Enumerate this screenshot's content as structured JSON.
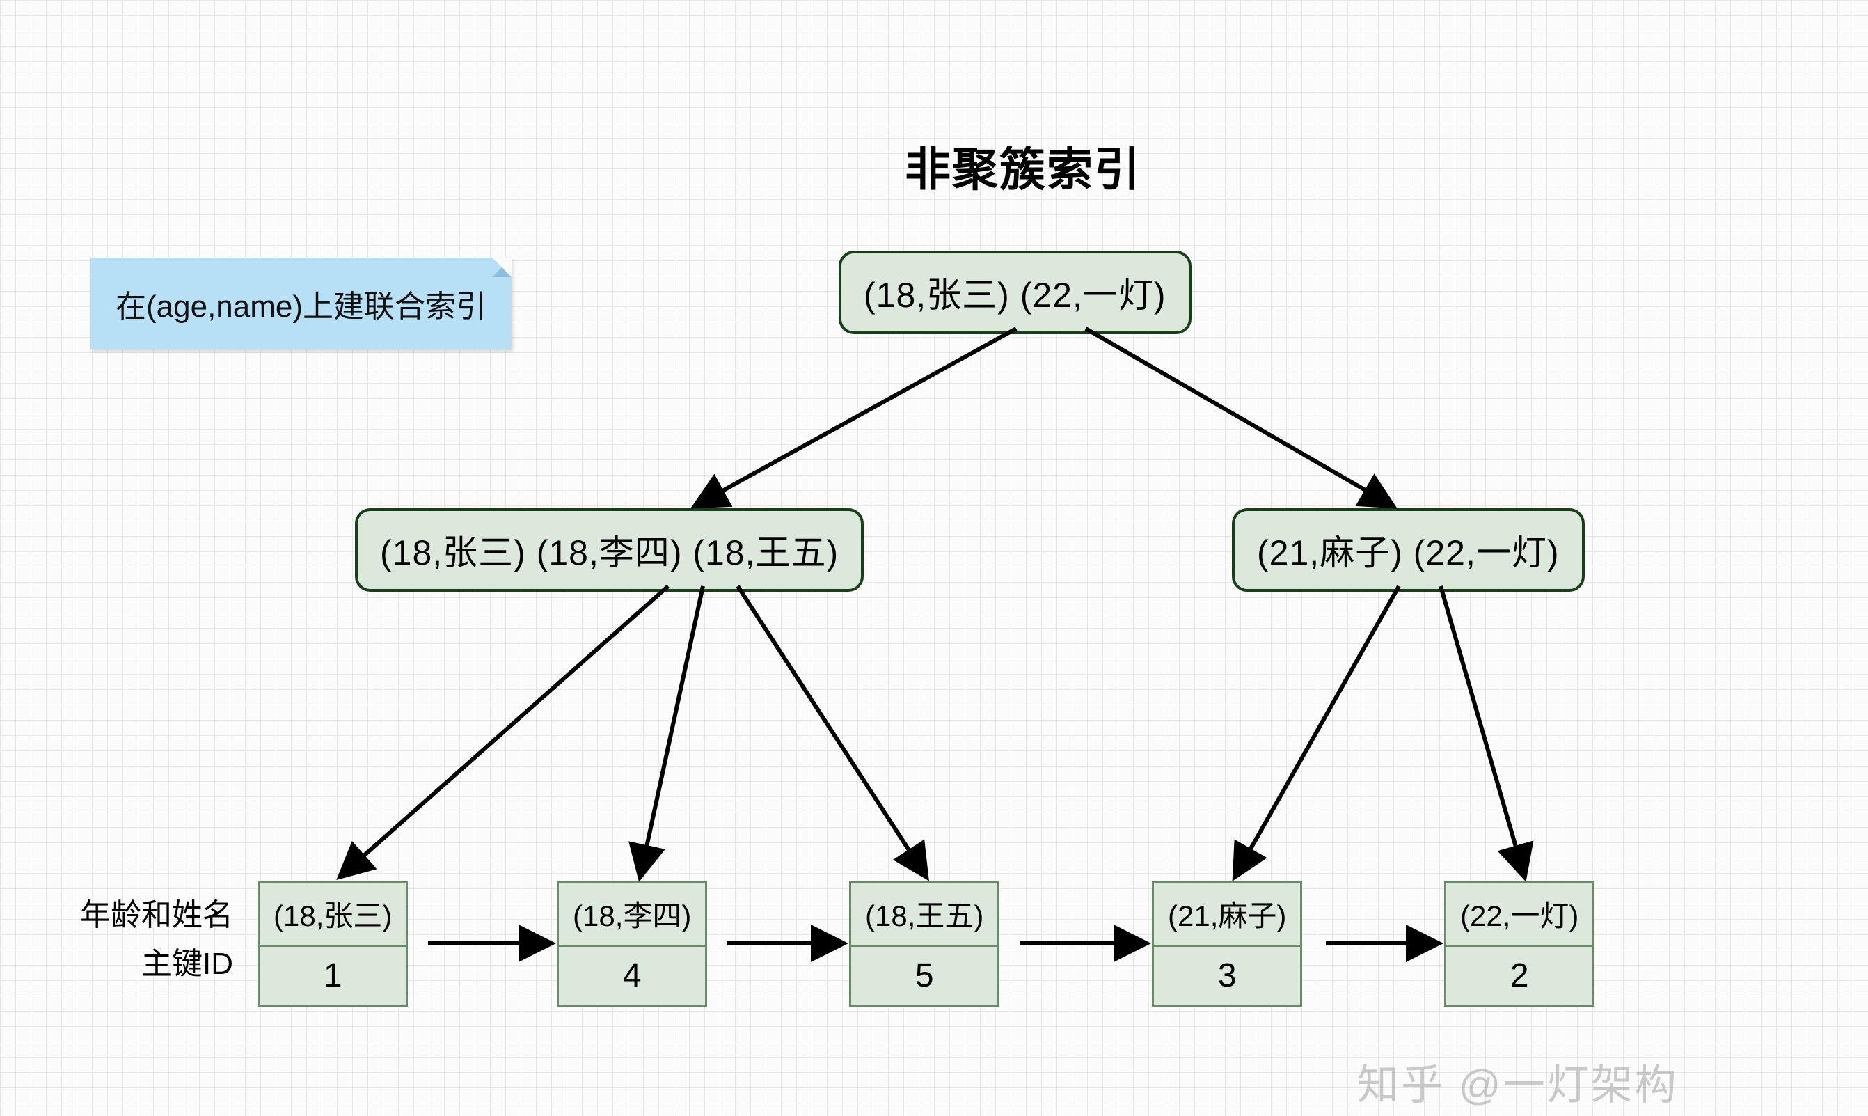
{
  "diagram": {
    "title": "非聚簇索引",
    "note": "在(age,name)上建联合索引",
    "root": "(18,张三) (22,一灯)",
    "mid_left": "(18,张三) (18,李四) (18,王五)",
    "mid_right": "(21,麻子) (22,一灯)",
    "row_label_line1": "年龄和姓名",
    "row_label_line2": "主键ID",
    "leaves": [
      {
        "key": "(18,张三)",
        "pk": "1"
      },
      {
        "key": "(18,李四)",
        "pk": "4"
      },
      {
        "key": "(18,王五)",
        "pk": "5"
      },
      {
        "key": "(21,麻子)",
        "pk": "3"
      },
      {
        "key": "(22,一灯)",
        "pk": "2"
      }
    ],
    "watermark": "知乎 @一灯架构"
  },
  "colors": {
    "node_fill": "#dde8dd",
    "node_border": "#184018",
    "leaf_border": "#698a69",
    "note_fill": "#b7dff5"
  }
}
